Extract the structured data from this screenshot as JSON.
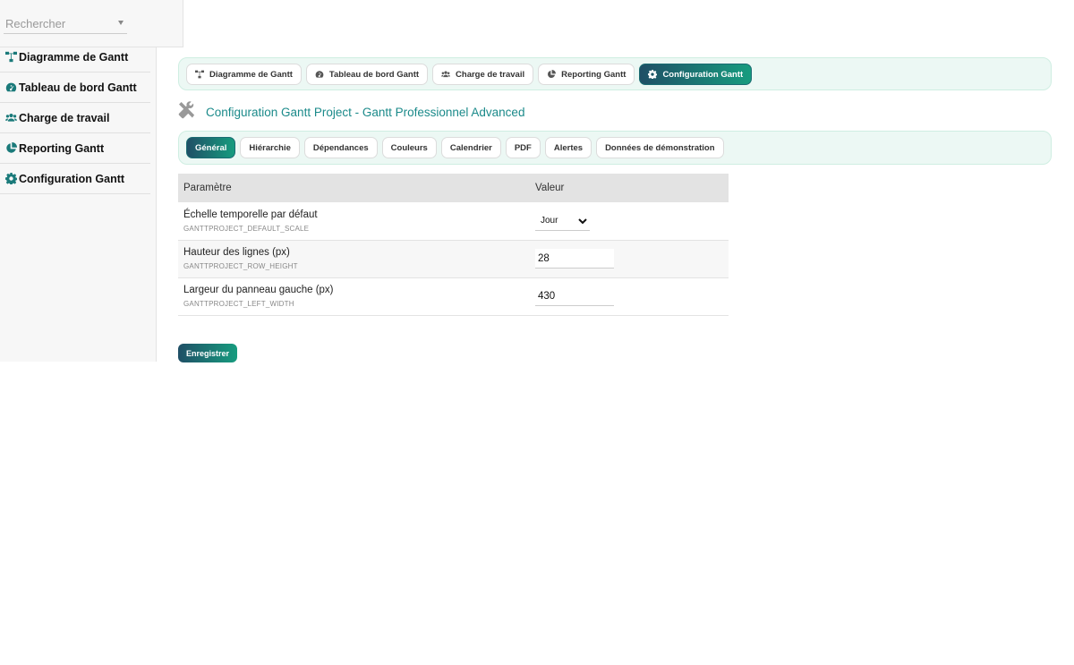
{
  "search": {
    "placeholder": "Rechercher"
  },
  "sidebar": {
    "items": [
      {
        "label": "Diagramme de Gantt",
        "icon": "diagram-icon"
      },
      {
        "label": "Tableau de bord Gantt",
        "icon": "dashboard-icon"
      },
      {
        "label": "Charge de travail",
        "icon": "users-icon"
      },
      {
        "label": "Reporting Gantt",
        "icon": "pie-chart-icon"
      },
      {
        "label": "Configuration Gantt",
        "icon": "gear-icon"
      }
    ]
  },
  "topnav": {
    "tabs": [
      {
        "label": "Diagramme de Gantt",
        "icon": "diagram-icon",
        "active": false
      },
      {
        "label": "Tableau de bord Gantt",
        "icon": "dashboard-icon",
        "active": false
      },
      {
        "label": "Charge de travail",
        "icon": "users-icon",
        "active": false
      },
      {
        "label": "Reporting Gantt",
        "icon": "pie-chart-icon",
        "active": false
      },
      {
        "label": "Configuration Gantt",
        "icon": "gear-icon",
        "active": true
      }
    ]
  },
  "page": {
    "title": "Configuration Gantt Project - Gantt Professionnel Advanced",
    "icon": "tools-icon"
  },
  "subnav": {
    "tabs": [
      {
        "label": "Général",
        "active": true
      },
      {
        "label": "Hiérarchie",
        "active": false
      },
      {
        "label": "Dépendances",
        "active": false
      },
      {
        "label": "Couleurs",
        "active": false
      },
      {
        "label": "Calendrier",
        "active": false
      },
      {
        "label": "PDF",
        "active": false
      },
      {
        "label": "Alertes",
        "active": false
      },
      {
        "label": "Données de démonstration",
        "active": false
      }
    ]
  },
  "table": {
    "headers": {
      "param": "Paramètre",
      "value": "Valeur"
    },
    "rows": [
      {
        "label": "Échelle temporelle par défaut",
        "key": "GANTTPROJECT_DEFAULT_SCALE",
        "type": "select",
        "value": "Jour"
      },
      {
        "label": "Hauteur des lignes (px)",
        "key": "GANTTPROJECT_ROW_HEIGHT",
        "type": "input",
        "value": "28"
      },
      {
        "label": "Largeur du panneau gauche (px)",
        "key": "GANTTPROJECT_LEFT_WIDTH",
        "type": "input",
        "value": "430"
      }
    ]
  },
  "actions": {
    "save_label": "Enregistrer"
  },
  "colors": {
    "accent_start": "#1f4f66",
    "accent_end": "#179c7f",
    "title": "#1b8a8a",
    "bar_bg": "#ecf8f4"
  }
}
